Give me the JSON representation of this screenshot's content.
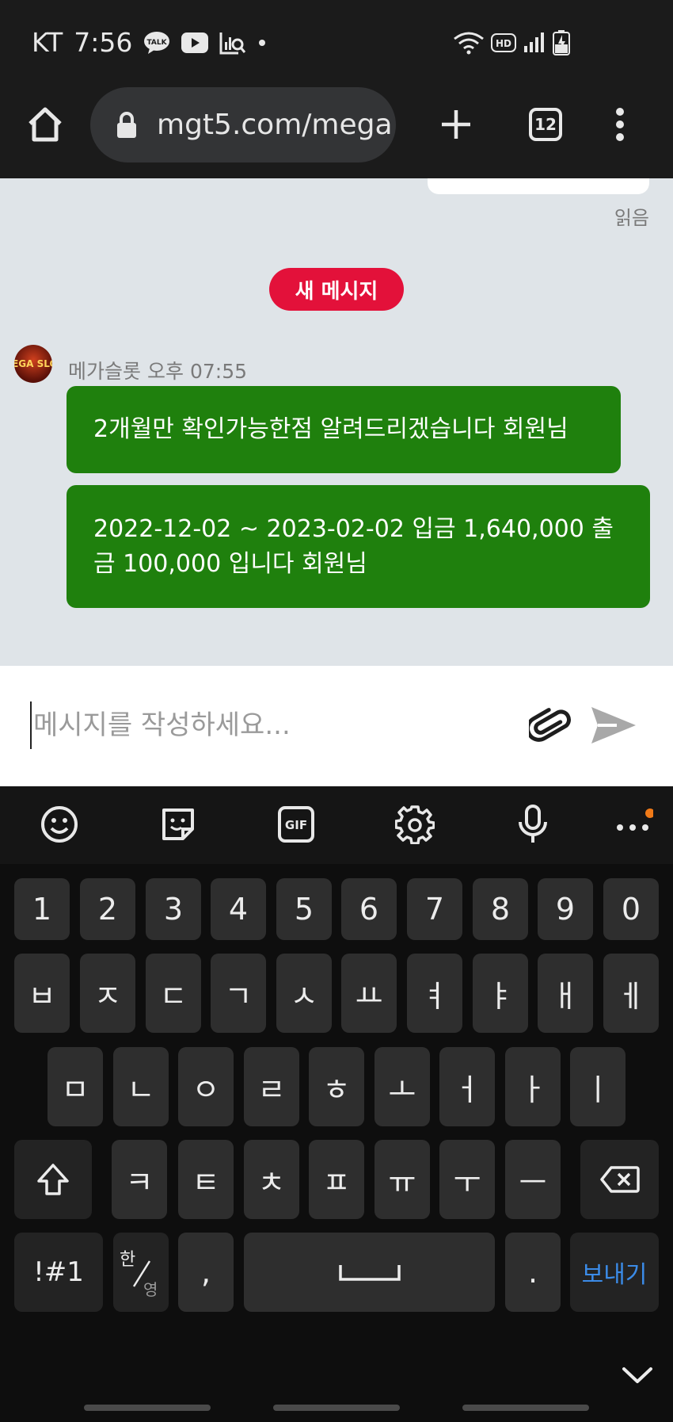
{
  "status_bar": {
    "carrier": "KT",
    "time": "7:56",
    "talk_badge": "TALK",
    "hd_badge": "HD"
  },
  "browser": {
    "url": "mgt5.com/mega",
    "tab_count": "12",
    "icons": [
      "home-icon",
      "lock-icon",
      "plus-icon",
      "tab-switcher-icon",
      "more-vert-icon"
    ]
  },
  "chat": {
    "read_label": "읽음",
    "new_message_label": "새 메시지",
    "sender": {
      "name": "메가슬롯",
      "time": "오후 07:55",
      "avatar_text": "MEGA SLOT"
    },
    "messages": [
      {
        "text": "2개월만 확인가능한점 알려드리겠습니다 회원님"
      },
      {
        "text": "2022-12-02 ~ 2023-02-02 입금 1,640,000 출금 100,000 입니다 회원님"
      }
    ],
    "colors": {
      "bubble": "#1f800d",
      "new_badge": "#e3113a",
      "background": "#dfe4e8"
    }
  },
  "composer": {
    "placeholder": "메시지를 작성하세요...",
    "icons": [
      "paperclip-icon",
      "send-icon"
    ]
  },
  "keyboard": {
    "toolbar_icons": [
      "emoji-icon",
      "sticker-icon",
      "gif-icon",
      "settings-icon",
      "mic-icon",
      "more-horiz-icon"
    ],
    "gif_label": "GIF",
    "row_numbers": [
      "1",
      "2",
      "3",
      "4",
      "5",
      "6",
      "7",
      "8",
      "9",
      "0"
    ],
    "row1": [
      "ㅂ",
      "ㅈ",
      "ㄷ",
      "ㄱ",
      "ㅅ",
      "ㅛ",
      "ㅕ",
      "ㅑ",
      "ㅐ",
      "ㅔ"
    ],
    "row2": [
      "ㅁ",
      "ㄴ",
      "ㅇ",
      "ㄹ",
      "ㅎ",
      "ㅗ",
      "ㅓ",
      "ㅏ",
      "ㅣ"
    ],
    "row3": [
      "ㅋ",
      "ㅌ",
      "ㅊ",
      "ㅍ",
      "ㅠ",
      "ㅜ",
      "ㅡ"
    ],
    "symbols_label": "!#1",
    "lang_top": "한",
    "lang_bottom": "영",
    "comma": ",",
    "period": ".",
    "send_label": "보내기"
  }
}
